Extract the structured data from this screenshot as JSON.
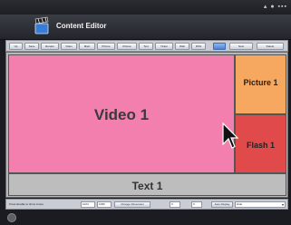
{
  "app": {
    "title": "Content Editor"
  },
  "toolbar": {
    "buttons": [
      {
        "label": "Up",
        "style": "default"
      },
      {
        "label": "Save",
        "style": "default"
      },
      {
        "label": "Render",
        "style": "default"
      },
      {
        "label": "Video",
        "style": "default"
      },
      {
        "label": "Main",
        "style": "default"
      },
      {
        "label": "Picture",
        "style": "default"
      },
      {
        "label": "Picture",
        "style": "default"
      },
      {
        "label": "Text",
        "style": "default"
      },
      {
        "label": "Ticker",
        "style": "default"
      },
      {
        "label": "Web",
        "style": "default"
      },
      {
        "label": "RSS",
        "style": "default"
      },
      {
        "label": "",
        "style": "blue"
      },
      {
        "label": "Next",
        "style": "default"
      },
      {
        "label": "Delete",
        "style": "default"
      }
    ]
  },
  "zones": {
    "video": {
      "label": "Video 1",
      "color": "#f27fae"
    },
    "picture": {
      "label": "Picture 1",
      "color": "#f7a860"
    },
    "flash": {
      "label": "Flash 1",
      "color": "#e14a4a"
    },
    "text": {
      "label": "Text 1",
      "color": "#bdbdbd"
    }
  },
  "bottombar": {
    "hint": "Press Enable to show zones",
    "resolution_w": "1024",
    "resolution_h": "1080",
    "change_button": "Change Dimension",
    "field_a": "0",
    "field_b": "0",
    "ratio_button": "Auto Display",
    "mode_select": "Hide"
  },
  "icons": {
    "logo": "clapperboard-icon",
    "cursor": "mouse-pointer-icon",
    "home": "home-button-icon"
  }
}
